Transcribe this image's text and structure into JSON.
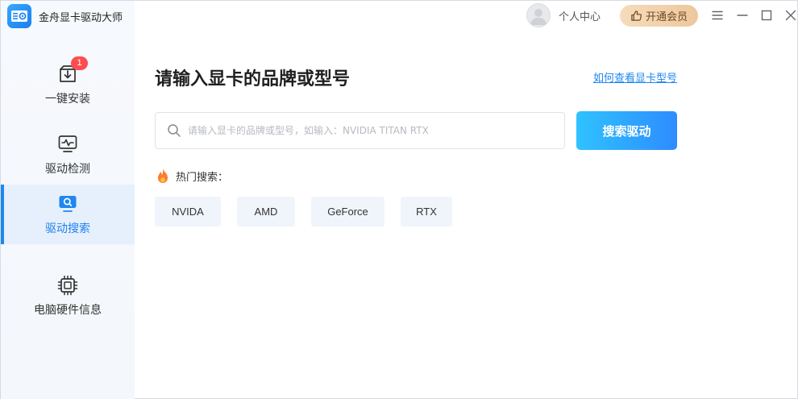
{
  "app": {
    "title": "金舟显卡驱动大师"
  },
  "sidebar": {
    "items": [
      {
        "label": "一键安装",
        "badge": "1"
      },
      {
        "label": "驱动检测"
      },
      {
        "label": "驱动搜索",
        "active": true
      },
      {
        "label": "电脑硬件信息"
      }
    ]
  },
  "topbar": {
    "user_label": "个人中心",
    "vip_label": "开通会员"
  },
  "main": {
    "title": "请输入显卡的品牌或型号",
    "help_link": "如何查看显卡型号",
    "search": {
      "placeholder": "请输入显卡的品牌或型号，如输入：NVIDIA TITAN RTX",
      "value": "",
      "button_label": "搜索驱动"
    },
    "hot": {
      "label": "热门搜索：",
      "tags": [
        "NVIDA",
        "AMD",
        "GeForce",
        "RTX"
      ]
    }
  },
  "colors": {
    "accent": "#1e87f0",
    "button_gradient_start": "#2fc2ff",
    "button_gradient_end": "#2e8cff",
    "badge": "#ff4d4f",
    "vip_gold": "#eec79c"
  }
}
